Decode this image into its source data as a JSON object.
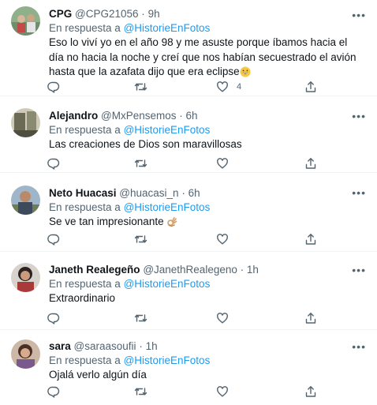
{
  "reply_prefix": "En respuesta a",
  "tweets": [
    {
      "name": "CPG",
      "handle": "@CPG21056",
      "dot": "·",
      "time": "9h",
      "reply_to": "@HistorieEnFotos",
      "text": "Eso lo viví yo en el año 98 y me asuste porque íbamos hacia el día no hacia la noche y creí que nos habían secuestrado el avión hasta que la azafata dijo que era eclipse",
      "text_emoji": "grinning-face-emoji",
      "likes": "4"
    },
    {
      "name": "Alejandro",
      "handle": "@MxPensemos",
      "dot": "·",
      "time": "6h",
      "reply_to": "@HistorieEnFotos",
      "text": "Las creaciones de Dios son maravillosas",
      "likes": ""
    },
    {
      "name": "Neto Huacasi",
      "handle": "@huacasi_n",
      "dot": "·",
      "time": "6h",
      "reply_to": "@HistorieEnFotos",
      "text": "Se ve tan impresionante",
      "text_emoji": "ok-hand-emoji",
      "likes": ""
    },
    {
      "name": "Janeth Realegeño",
      "handle": "@JanethRealegeno",
      "dot": "·",
      "time": "1h",
      "reply_to": "@HistorieEnFotos",
      "text": "Extraordinario",
      "likes": ""
    },
    {
      "name": "sara",
      "handle": "@saraasoufii",
      "dot": "·",
      "time": "1h",
      "reply_to": "@HistorieEnFotos",
      "text": "Ojalá verlo algún día",
      "likes": ""
    }
  ],
  "icons": {
    "more": "more-options-icon",
    "reply": "reply-icon",
    "retweet": "retweet-icon",
    "like": "like-icon",
    "share": "share-icon"
  },
  "colors": {
    "link": "#1d9bf0",
    "secondary_text": "#536471",
    "primary_text": "#0f1419",
    "divider": "#eff3f4"
  }
}
